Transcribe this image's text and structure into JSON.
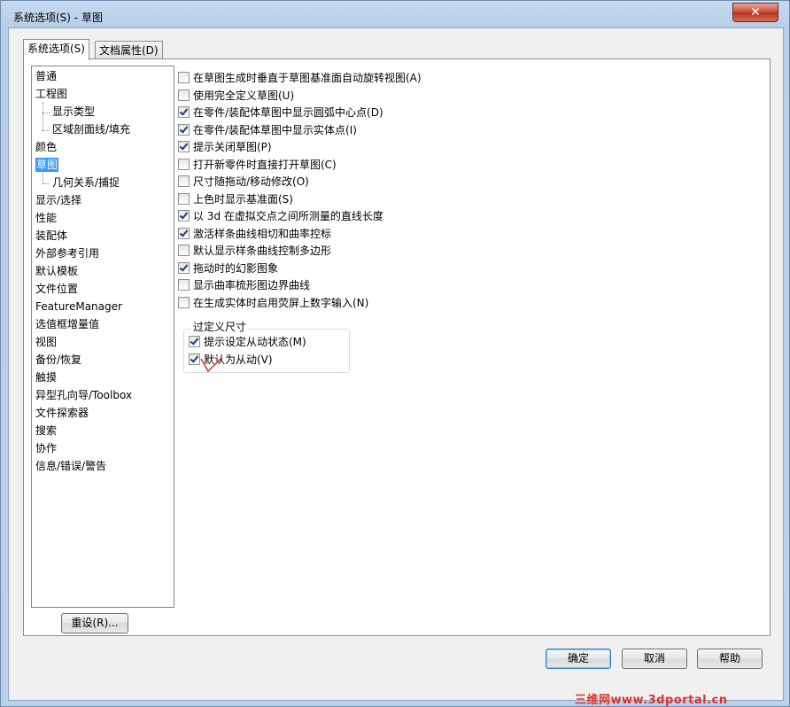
{
  "window": {
    "title": "系统选项(S) - 草图",
    "close_symbol": "✕"
  },
  "tabs": [
    {
      "label": "系统选项(S)",
      "active": true
    },
    {
      "label": "文档属性(D)",
      "active": false
    }
  ],
  "tree": {
    "items": [
      {
        "label": "普通",
        "level": 0,
        "selected": false
      },
      {
        "label": "工程图",
        "level": 0,
        "selected": false
      },
      {
        "label": "显示类型",
        "level": 1,
        "selected": false
      },
      {
        "label": "区域剖面线/填充",
        "level": 1,
        "selected": false
      },
      {
        "label": "颜色",
        "level": 0,
        "selected": false
      },
      {
        "label": "草图",
        "level": 0,
        "selected": true
      },
      {
        "label": "几何关系/捕捉",
        "level": 1,
        "selected": false
      },
      {
        "label": "显示/选择",
        "level": 0,
        "selected": false
      },
      {
        "label": "性能",
        "level": 0,
        "selected": false
      },
      {
        "label": "装配体",
        "level": 0,
        "selected": false
      },
      {
        "label": "外部参考引用",
        "level": 0,
        "selected": false
      },
      {
        "label": "默认模板",
        "level": 0,
        "selected": false
      },
      {
        "label": "文件位置",
        "level": 0,
        "selected": false
      },
      {
        "label": "FeatureManager",
        "level": 0,
        "selected": false
      },
      {
        "label": "选值框增量值",
        "level": 0,
        "selected": false
      },
      {
        "label": "视图",
        "level": 0,
        "selected": false
      },
      {
        "label": "备份/恢复",
        "level": 0,
        "selected": false
      },
      {
        "label": "触摸",
        "level": 0,
        "selected": false
      },
      {
        "label": "异型孔向导/Toolbox",
        "level": 0,
        "selected": false
      },
      {
        "label": "文件探索器",
        "level": 0,
        "selected": false
      },
      {
        "label": "搜索",
        "level": 0,
        "selected": false
      },
      {
        "label": "协作",
        "level": 0,
        "selected": false
      },
      {
        "label": "信息/错误/警告",
        "level": 0,
        "selected": false
      }
    ]
  },
  "options": [
    {
      "label": "在草图生成时垂直于草图基准面自动旋转视图(A)",
      "checked": false
    },
    {
      "label": "使用完全定义草图(U)",
      "checked": false
    },
    {
      "label": "在零件/装配体草图中显示圆弧中心点(D)",
      "checked": true
    },
    {
      "label": "在零件/装配体草图中显示实体点(I)",
      "checked": true
    },
    {
      "label": "提示关闭草图(P)",
      "checked": true
    },
    {
      "label": "打开新零件时直接打开草图(C)",
      "checked": false
    },
    {
      "label": "尺寸随拖动/移动修改(O)",
      "checked": false
    },
    {
      "label": "上色时显示基准面(S)",
      "checked": false
    },
    {
      "label": "以 3d 在虚拟交点之间所测量的直线长度",
      "checked": true
    },
    {
      "label": "激活样条曲线相切和曲率控标",
      "checked": true
    },
    {
      "label": "默认显示样条曲线控制多边形",
      "checked": false
    },
    {
      "label": "拖动时的幻影图象",
      "checked": true
    },
    {
      "label": "显示曲率梳形图边界曲线",
      "checked": false
    },
    {
      "label": "在生成实体时启用荧屏上数字输入(N)",
      "checked": false
    }
  ],
  "overdefined_group": {
    "title": "过定义尺寸",
    "options": [
      {
        "label": "提示设定从动状态(M)",
        "checked": true
      },
      {
        "label": "默认为从动(V)",
        "checked": true
      }
    ]
  },
  "buttons": {
    "reset": "重设(R)...",
    "ok": "确定",
    "cancel": "取消",
    "help": "帮助"
  },
  "watermark": "三维网www.3dportal.cn",
  "colors": {
    "selection": "#3399ff",
    "watermark": "#e0302a",
    "annotation": "#e0302a"
  }
}
